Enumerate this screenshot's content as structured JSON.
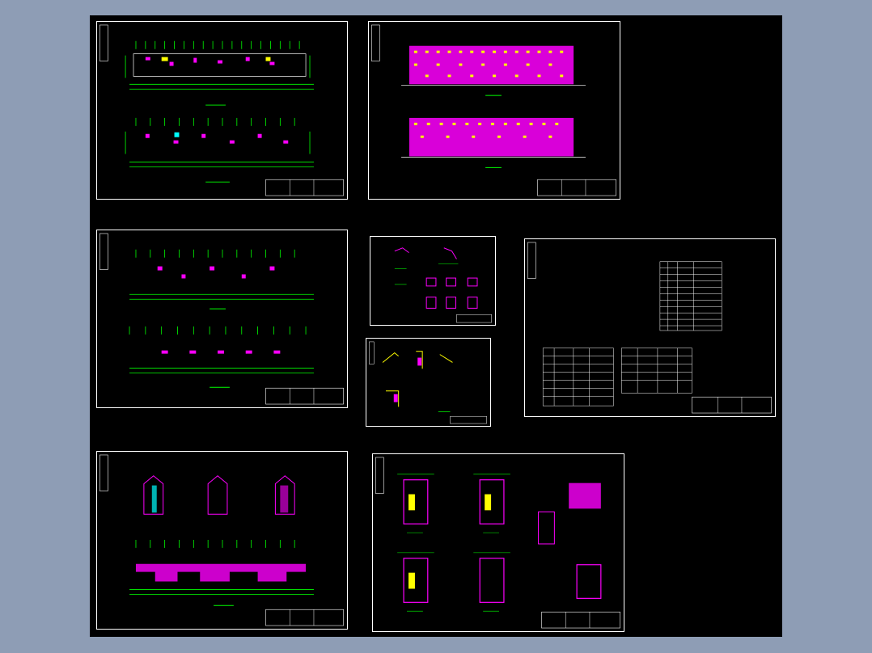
{
  "background": "#8e9db5",
  "drawing_area": "#000000",
  "colors": {
    "frame": "#ffffff",
    "dimension": "#00ff00",
    "structure": "#ff00ff",
    "text": "#ffffff",
    "accent_cyan": "#00ffff",
    "accent_yellow": "#ffff00",
    "accent_red": "#ff3030"
  },
  "sheets": [
    {
      "id": "plans-1",
      "title_label": ""
    },
    {
      "id": "elevations",
      "title_label": ""
    },
    {
      "id": "plans-2",
      "title_label": ""
    },
    {
      "id": "details-1",
      "title_label": ""
    },
    {
      "id": "details-2",
      "title_label": ""
    },
    {
      "id": "notes-tables",
      "title_label": ""
    },
    {
      "id": "sections-roof",
      "title_label": ""
    },
    {
      "id": "stair-details",
      "title_label": ""
    }
  ]
}
